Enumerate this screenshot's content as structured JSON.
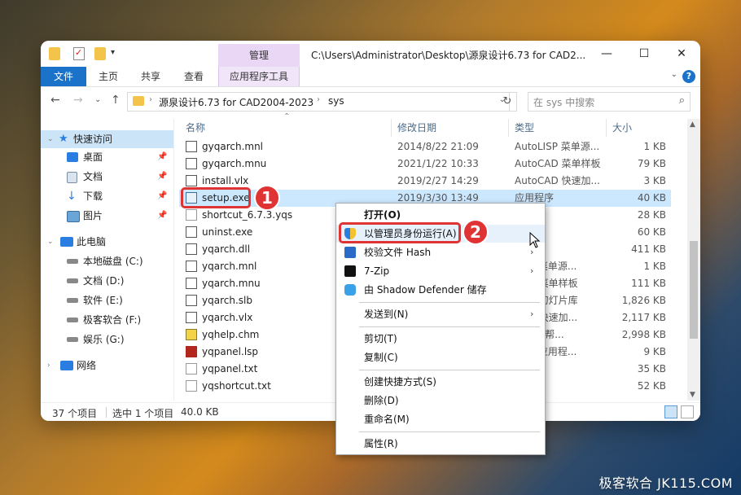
{
  "window": {
    "context_tab_header": "管理",
    "title": "C:\\Users\\Administrator\\Desktop\\源泉设计6.73 for CAD2...",
    "controls": {
      "minimize": "—",
      "maximize": "☐",
      "close": "✕"
    }
  },
  "ribbon": {
    "tabs": [
      {
        "label": "文件"
      },
      {
        "label": "主页"
      },
      {
        "label": "共享"
      },
      {
        "label": "查看"
      },
      {
        "label": "应用程序工具"
      }
    ],
    "help": "?"
  },
  "address": {
    "crumbs": [
      "源泉设计6.73 for CAD2004-2023",
      "sys"
    ],
    "search_placeholder": "在 sys 中搜索"
  },
  "nav": {
    "items": [
      {
        "label": "快速访问",
        "pinned": false
      },
      {
        "label": "桌面",
        "pinned": true
      },
      {
        "label": "文档",
        "pinned": true
      },
      {
        "label": "下载",
        "pinned": true
      },
      {
        "label": "图片",
        "pinned": true
      },
      {
        "label": "此电脑",
        "pinned": false
      },
      {
        "label": "本地磁盘 (C:)",
        "pinned": false
      },
      {
        "label": "文档 (D:)",
        "pinned": false
      },
      {
        "label": "软件 (E:)",
        "pinned": false
      },
      {
        "label": "极客软合 (F:)",
        "pinned": false
      },
      {
        "label": "娱乐 (G:)",
        "pinned": false
      },
      {
        "label": "网络",
        "pinned": false
      }
    ]
  },
  "columns": {
    "name": "名称",
    "modified": "修改日期",
    "type": "类型",
    "size": "大小"
  },
  "files": [
    {
      "name": "gyqarch.mnl",
      "modified": "2014/8/22 21:09",
      "type": "AutoLISP 菜单源...",
      "size": "1 KB"
    },
    {
      "name": "gyqarch.mnu",
      "modified": "2021/1/22 10:33",
      "type": "AutoCAD 菜单样板",
      "size": "79 KB"
    },
    {
      "name": "install.vlx",
      "modified": "2019/2/27 14:29",
      "type": "AutoCAD 快速加...",
      "size": "3 KB"
    },
    {
      "name": "setup.exe",
      "modified": "2019/3/30 13:49",
      "type": "应用程序",
      "size": "40 KB"
    },
    {
      "name": "shortcut_6.7.3.yqs",
      "modified": "",
      "type": "件",
      "size": "28 KB"
    },
    {
      "name": "uninst.exe",
      "modified": "",
      "type": "序",
      "size": "60 KB"
    },
    {
      "name": "yqarch.dll",
      "modified": "",
      "type": "序扩展",
      "size": "411 KB"
    },
    {
      "name": "yqarch.mnl",
      "modified": "",
      "type": "LISP 菜单源...",
      "size": "1 KB"
    },
    {
      "name": "yqarch.mnu",
      "modified": "",
      "type": "CAD 菜单样板",
      "size": "111 KB"
    },
    {
      "name": "yqarch.slb",
      "modified": "",
      "type": "CAD 幻灯片库",
      "size": "1,826 KB"
    },
    {
      "name": "yqarch.vlx",
      "modified": "",
      "type": "CAD 快速加...",
      "size": "2,117 KB"
    },
    {
      "name": "yqhelp.chm",
      "modified": "",
      "type": "HTML 帮...",
      "size": "2,998 KB"
    },
    {
      "name": "yqpanel.lsp",
      "modified": "",
      "type": "LISP 应用程...",
      "size": "9 KB"
    },
    {
      "name": "yqpanel.txt",
      "modified": "",
      "type": "当",
      "size": "35 KB"
    },
    {
      "name": "yqshortcut.txt",
      "modified": "",
      "type": "当",
      "size": "52 KB"
    }
  ],
  "status": {
    "count": "37 个项目",
    "selected": "选中 1 个项目",
    "size": "40.0 KB"
  },
  "context_menu": {
    "items": [
      {
        "label": "打开(O)"
      },
      {
        "label": "以管理员身份运行(A)"
      },
      {
        "label": "校验文件 Hash"
      },
      {
        "label": "7-Zip"
      },
      {
        "label": "由 Shadow Defender 储存"
      },
      {
        "label": "发送到(N)"
      },
      {
        "label": "剪切(T)"
      },
      {
        "label": "复制(C)"
      },
      {
        "label": "创建快捷方式(S)"
      },
      {
        "label": "删除(D)"
      },
      {
        "label": "重命名(M)"
      },
      {
        "label": "属性(R)"
      }
    ]
  },
  "annotations": {
    "step1": "1",
    "step2": "2"
  },
  "watermark": "极客软合 JK115.COM",
  "colors": {
    "accent": "#1a73c8",
    "highlight": "#e03333",
    "selection": "#cce8ff"
  }
}
